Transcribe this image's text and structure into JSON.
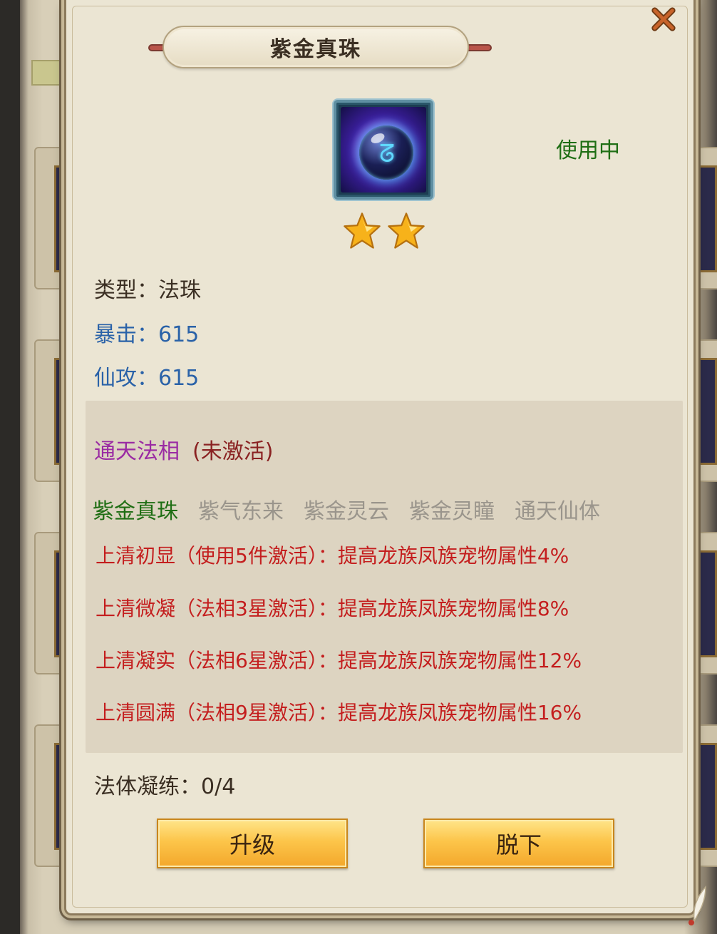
{
  "popup": {
    "title": "紫金真珠",
    "status": "使用中",
    "star_count": 2,
    "colors": {
      "accent": "#c41e1e",
      "positive": "#1f6e14",
      "stat": "#2a62a8",
      "set_name": "#9a2aa3"
    }
  },
  "attributes": {
    "type": "类型：法珠",
    "crit": "暴击：615",
    "attack": "仙攻：615"
  },
  "set": {
    "name": "通天法相",
    "state": "(未激活)",
    "members": [
      {
        "label": "紫金真珠",
        "active": true
      },
      {
        "label": "紫气东来",
        "active": false
      },
      {
        "label": "紫金灵云",
        "active": false
      },
      {
        "label": "紫金灵瞳",
        "active": false
      },
      {
        "label": "通天仙体",
        "active": false
      }
    ],
    "bonuses": [
      "上清初显（使用5件激活）：提高龙族凤族宠物属性4%",
      "上清微凝（法相3星激活）：提高龙族凤族宠物属性8%",
      "上清凝实（法相6星激活）：提高龙族凤族宠物属性12%",
      "上清圆满（法相9星激活）：提高龙族凤族宠物属性16%"
    ]
  },
  "refine": "法体凝练：0/4",
  "buttons": {
    "upgrade": "升级",
    "unequip": "脱下"
  },
  "icons": {
    "close": "close-icon",
    "item": "purple-orb-icon",
    "star": "star-icon"
  }
}
